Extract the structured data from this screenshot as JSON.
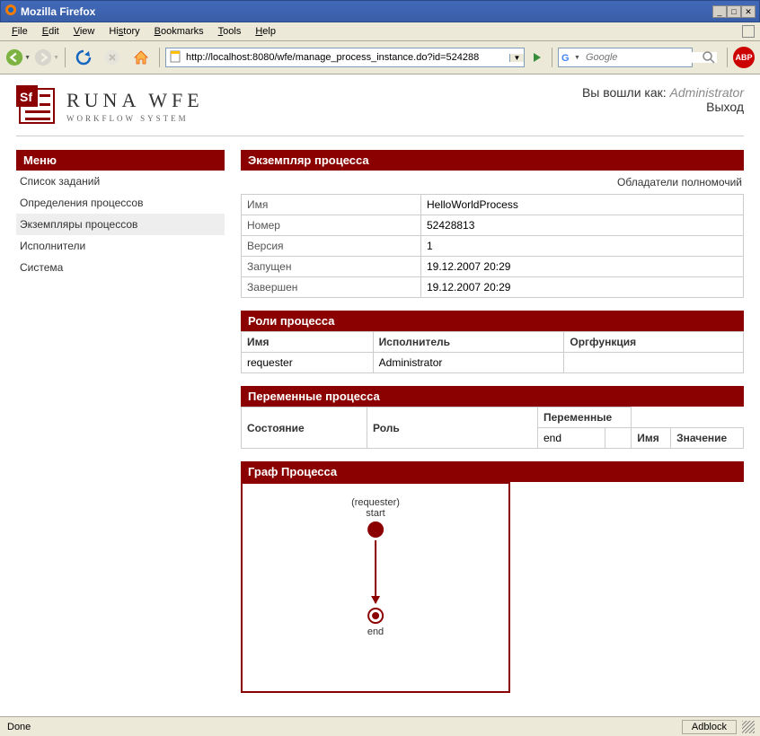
{
  "window": {
    "title": "Mozilla Firefox"
  },
  "menubar": {
    "file": "File",
    "edit": "Edit",
    "view": "View",
    "history": "History",
    "bookmarks": "Bookmarks",
    "tools": "Tools",
    "help": "Help"
  },
  "toolbar": {
    "url": "http://localhost:8080/wfe/manage_process_instance.do?id=524288",
    "search_placeholder": "Google"
  },
  "app": {
    "logo_main": "RUNA WFE",
    "logo_sub": "WORKFLOW SYSTEM",
    "logged_in_prefix": "Вы вошли как: ",
    "user": "Administrator",
    "logout": "Выход"
  },
  "sidebar": {
    "title": "Меню",
    "items": [
      {
        "label": "Список заданий"
      },
      {
        "label": "Определения процессов"
      },
      {
        "label": "Экземпляры процессов",
        "active": true
      },
      {
        "label": "Исполнители"
      },
      {
        "label": "Система"
      }
    ]
  },
  "instance": {
    "title": "Экземпляр процесса",
    "permissions_link": "Обладатели полномочий",
    "rows": {
      "name_label": "Имя",
      "name": "HelloWorldProcess",
      "id_label": "Номер",
      "id": "52428813",
      "version_label": "Версия",
      "version": "1",
      "started_label": "Запущен",
      "started": "19.12.2007 20:29",
      "ended_label": "Завершен",
      "ended": "19.12.2007 20:29"
    }
  },
  "roles": {
    "title": "Роли процесса",
    "headers": {
      "name": "Имя",
      "executor": "Исполнитель",
      "orgfunc": "Оргфункция"
    },
    "row": {
      "name": "requester",
      "executor": "Administrator",
      "orgfunc": ""
    }
  },
  "vars": {
    "title": "Переменные процесса",
    "headers": {
      "state": "Состояние",
      "role": "Роль",
      "vars": "Переменные",
      "varname": "Имя",
      "value": "Значение"
    },
    "row": {
      "state": "end",
      "role": "",
      "varname": "",
      "value": ""
    }
  },
  "graph": {
    "title": "Граф Процесса",
    "start_role": "(requester)",
    "start_label": "start",
    "end_label": "end"
  },
  "statusbar": {
    "status": "Done",
    "adblock": "Adblock"
  }
}
